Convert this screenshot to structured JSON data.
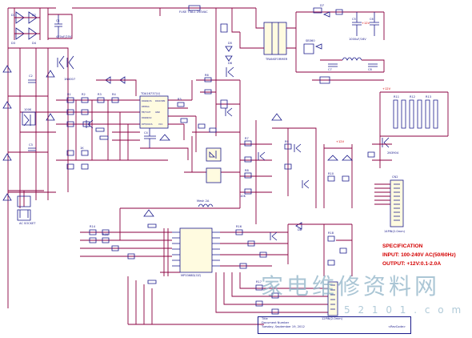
{
  "specification": {
    "heading": "SPECIFICATION",
    "input": "INPUT: 100-240V AC(50/60Hz)",
    "output": "OUTPUT: +12V:0.1-2.0A"
  },
  "watermark": {
    "text": "家电维修资料网",
    "url": "5 2 1 0 1 . c o m"
  },
  "labels": {
    "fuse": "FUSE T3A-L 250VAC",
    "ac_socket": "AC SOCKET",
    "tda_chip": "TDA16737(V)",
    "ic_pins": [
      "DRAIN/VS",
      "DEMAG",
      "FB/TOUT",
      "DRAIN/SC",
      "DDIAT/PN",
      "GND",
      "DPT/DOCS",
      "VCC"
    ],
    "pwm_chip": "MP3368D(OZ)",
    "transformer": "TRANSFORMER",
    "connector": "CN2",
    "connector_label": "14PIN(2.0mm)",
    "connector2": "12PIN(2.0mm)",
    "inductor": "Mesh 2A",
    "title_block": [
      "Title",
      "Document Number",
      "Tuesday, September 19, 2012"
    ],
    "rev": "<RevCode>",
    "plus12v": "+12V",
    "diodes": [
      "D1",
      "D2",
      "D3",
      "D4",
      "D5",
      "D6",
      "D7",
      "D8"
    ],
    "resistors": [
      "R1",
      "R2",
      "R3",
      "R4",
      "R5",
      "R6",
      "R7",
      "R8",
      "R9",
      "R10",
      "R11",
      "R12",
      "R13",
      "R14",
      "R15",
      "R16",
      "R17",
      "R18",
      "R19",
      "R20",
      "R21",
      "R22",
      "R23",
      "R24",
      "R25",
      "R26",
      "R27",
      "R28",
      "R29",
      "R30",
      "R31",
      "R32",
      "R33",
      "R34",
      "R35",
      "R36"
    ],
    "caps": [
      "C1",
      "C2",
      "C3",
      "C4",
      "C5",
      "C6",
      "C7",
      "C8",
      "C9",
      "C10",
      "C11",
      "C12",
      "C13",
      "C14",
      "C15",
      "C16",
      "C17",
      "C18"
    ],
    "values": [
      "100K",
      "1K",
      "10K",
      "47K",
      "4.7K",
      "2.2K",
      "470uF/25V",
      "1000uF/16V",
      "100nF",
      "47nF",
      "220uF",
      "10uF/50V",
      "0.1uF",
      "1N4007",
      "FR107",
      "SB360",
      "2N3904"
    ]
  },
  "colors": {
    "wire": "#8b0040",
    "component": "#1a1a8a",
    "text_red": "#d40000",
    "ic_fill": "#fffbe0",
    "watermark": "#8fb4c8"
  }
}
